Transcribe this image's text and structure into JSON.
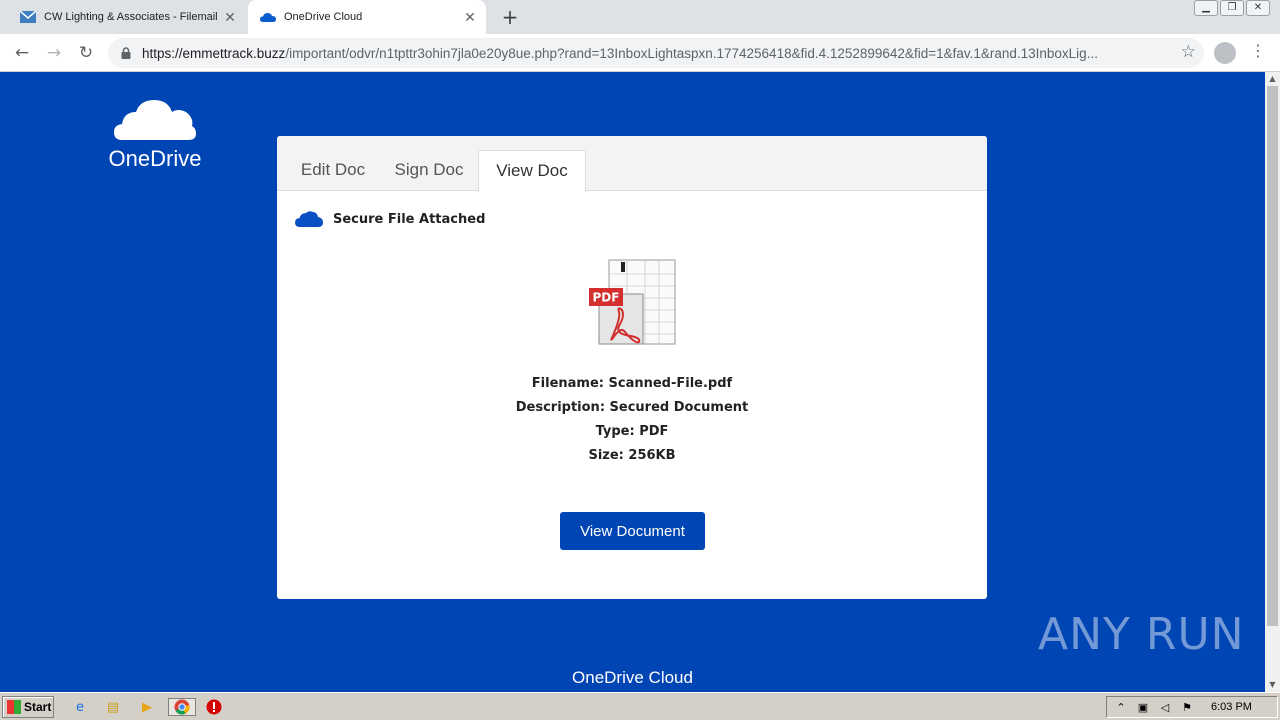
{
  "browser": {
    "tabs": [
      {
        "title": "CW Lighting & Associates - Filemail",
        "close": "✕"
      },
      {
        "title": "OneDrive Cloud",
        "close": "✕"
      }
    ],
    "new_tab": "+",
    "url_host": "https://emmettrack.buzz",
    "url_path": "/important/odvr/n1tpttr3ohin7jla0e20y8ue.php?rand=13InboxLightaspxn.1774256418&fid.4.1252899642&fid=1&fav.1&rand.13InboxLig..."
  },
  "page": {
    "logo_text": "OneDrive",
    "tabs": [
      "Edit Doc",
      "Sign Doc",
      "View Doc"
    ],
    "secure_label": "Secure File Attached",
    "pdf_badge": "PDF",
    "file": {
      "filename": "Filename: Scanned-File.pdf",
      "description": "Description: Secured Document",
      "type": "Type: PDF",
      "size": "Size: 256KB"
    },
    "view_button": "View Document",
    "footer": "OneDrive Cloud",
    "watermark": "ANY RUN"
  },
  "taskbar": {
    "start": "Start",
    "clock": "6:03 PM"
  },
  "colors": {
    "page_bg": "#0045b4",
    "button_bg": "#0045b4"
  }
}
